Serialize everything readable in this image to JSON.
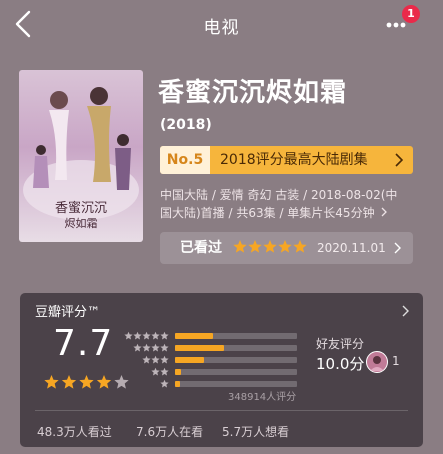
{
  "header": {
    "title": "电视",
    "notification_count": "1",
    "back_icon": "chevron-left-icon",
    "more_icon": "more-dots-icon"
  },
  "show": {
    "title": "香蜜沉沉烬如霜",
    "year": "(2018)",
    "rank": {
      "number": "No.5",
      "text": "2018评分最高大陆剧集"
    },
    "meta_line1": "中国大陆 / 爱情 奇幻 古装 / 2018-08-02(中",
    "meta_line2": "国大陆)首播 / 共63集 / 单集片长45分钟",
    "watched": {
      "label": "已看过",
      "user_stars": 5,
      "date": "2020.11.01"
    }
  },
  "rating": {
    "title": "豆瓣评分™",
    "score": "7.7",
    "stars": 4,
    "distribution": [
      {
        "stars": 5,
        "fraction": 0.31
      },
      {
        "stars": 4,
        "fraction": 0.4
      },
      {
        "stars": 3,
        "fraction": 0.24
      },
      {
        "stars": 2,
        "fraction": 0.05
      },
      {
        "stars": 1,
        "fraction": 0.04
      }
    ],
    "count_text": "348914人评分",
    "friends": {
      "label": "好友评分",
      "score": "10.0分",
      "count": "1"
    },
    "audience": {
      "watched": "48.3万人看过",
      "watching": "7.6万人在看",
      "want": "5.7万人想看"
    }
  },
  "colors": {
    "background": "#8a7d83",
    "accent_gold": "#f6b53c",
    "star": "#f6a623",
    "badge_red": "#ea2a4a"
  }
}
